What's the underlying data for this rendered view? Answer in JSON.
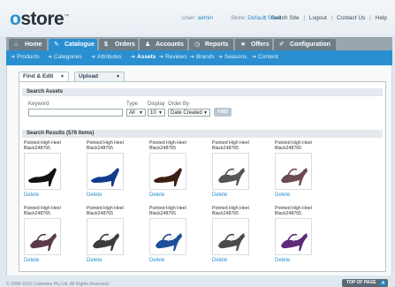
{
  "header": {
    "logo_prefix": "o",
    "logo_rest": "store",
    "logo_tm": "™",
    "user_label": "User:",
    "user_value": "admin",
    "store_label": "Store:",
    "store_value": "Default Store",
    "links": [
      "Switch Site",
      "Logout",
      "Contact Us",
      "Help"
    ],
    "separator": "|"
  },
  "main_nav": [
    {
      "label": "Home",
      "icon": "home-icon",
      "glyph": "⌂"
    },
    {
      "label": "Catalogue",
      "icon": "tag-icon",
      "glyph": "✎",
      "active": true
    },
    {
      "label": "Orders",
      "icon": "dollar-icon",
      "glyph": "$"
    },
    {
      "label": "Accounts",
      "icon": "user-icon",
      "glyph": "♟"
    },
    {
      "label": "Reports",
      "icon": "clock-icon",
      "glyph": "◷"
    },
    {
      "label": "Offers",
      "icon": "star-icon",
      "glyph": "★"
    },
    {
      "label": "Configuration",
      "icon": "wrench-icon",
      "glyph": "✐"
    }
  ],
  "sub_nav": [
    {
      "label": "Products"
    },
    {
      "label": "Categories"
    },
    {
      "label": "Attributes"
    },
    {
      "label": "Assets",
      "active": true
    },
    {
      "label": "Reviews"
    },
    {
      "label": "Brands"
    },
    {
      "label": "Seasons"
    },
    {
      "label": "Content"
    }
  ],
  "sub_nav_arrow": "➔",
  "content_tabs": [
    {
      "label": "Find & Edit",
      "active": true
    },
    {
      "label": "Upload"
    }
  ],
  "search": {
    "title": "Search Assets",
    "keyword_label": "Keyword",
    "keyword_value": "",
    "type_label": "Type",
    "type_value": "All",
    "display_label": "Display",
    "display_value": "10",
    "order_label": "Order By",
    "order_value": "Date Created",
    "find_label": "FIND"
  },
  "results": {
    "title": "Search Results (576 Items)",
    "delete_label": "Delete",
    "items": [
      {
        "name": "Pointed High Heel",
        "sku": "Black248765",
        "color": "#111111"
      },
      {
        "name": "Pointed High Heel",
        "sku": "Black248765",
        "color": "#123c8c"
      },
      {
        "name": "Pointed High Heel",
        "sku": "Black248765",
        "color": "#3b1e12"
      },
      {
        "name": "Pointed High Heel",
        "sku": "Black248765",
        "color": "#555555"
      },
      {
        "name": "Pointed High Heel",
        "sku": "Black248765",
        "color": "#6b4a52"
      },
      {
        "name": "Pointed High Heel",
        "sku": "Black248765",
        "color": "#5a3a4a"
      },
      {
        "name": "Pointed High Heel",
        "sku": "Black248765",
        "color": "#3c3c3c"
      },
      {
        "name": "Pointed High Heel",
        "sku": "Black248765",
        "color": "#1f4e9a"
      },
      {
        "name": "Pointed High Heel",
        "sku": "Black248765",
        "color": "#4a4a4a"
      },
      {
        "name": "Pointed High Heel",
        "sku": "Black248765",
        "color": "#5d2a7a"
      }
    ]
  },
  "footer": {
    "copyright": "© 2008-2010 Codewise Pty Ltd. All Rights Reserved.",
    "top_label": "TOP OF PAGE",
    "top_glyph": "▲"
  }
}
